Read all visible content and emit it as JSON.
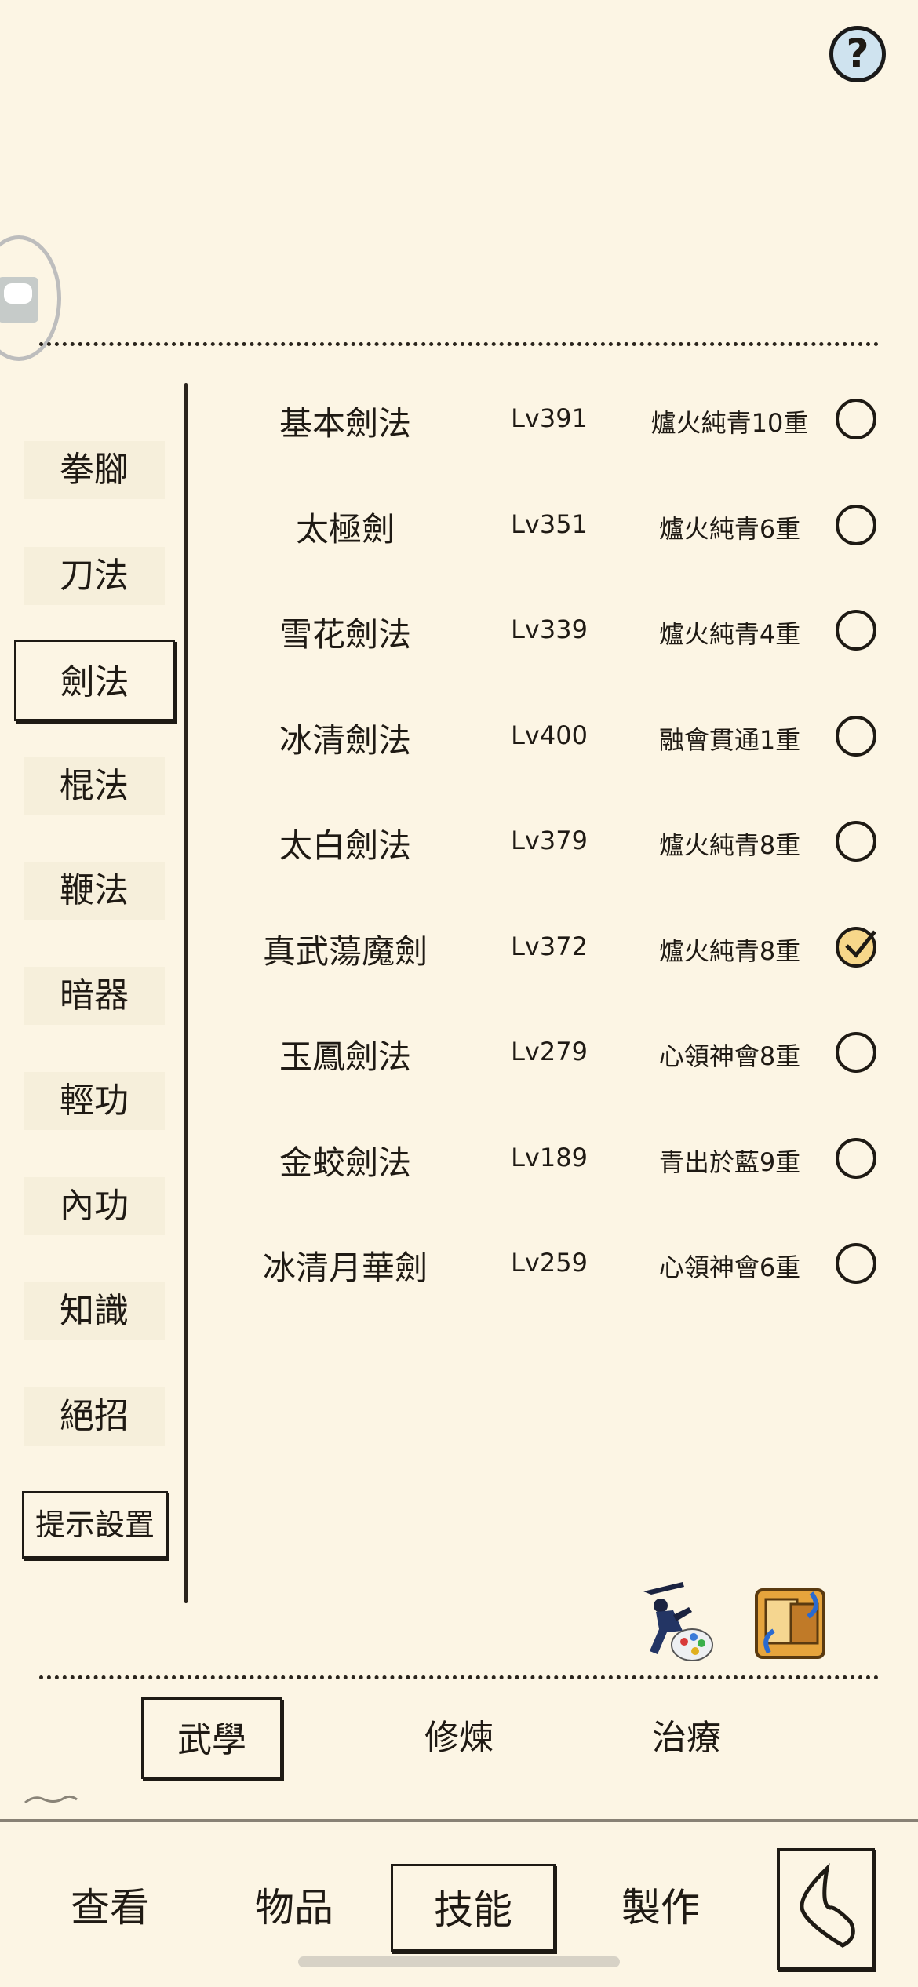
{
  "help": {
    "label": "?"
  },
  "categories": [
    {
      "label": "拳腳"
    },
    {
      "label": "刀法"
    },
    {
      "label": "劍法",
      "selected": true
    },
    {
      "label": "棍法"
    },
    {
      "label": "鞭法"
    },
    {
      "label": "暗器"
    },
    {
      "label": "輕功"
    },
    {
      "label": "內功"
    },
    {
      "label": "知識"
    },
    {
      "label": "絕招"
    }
  ],
  "hint_settings": {
    "label": "提示設置"
  },
  "skills": [
    {
      "name": "基本劍法",
      "level": "Lv391",
      "rank": "爐火純青10重",
      "checked": false
    },
    {
      "name": "太極劍",
      "level": "Lv351",
      "rank": "爐火純青6重",
      "checked": false
    },
    {
      "name": "雪花劍法",
      "level": "Lv339",
      "rank": "爐火純青4重",
      "checked": false
    },
    {
      "name": "冰清劍法",
      "level": "Lv400",
      "rank": "融會貫通1重",
      "checked": false
    },
    {
      "name": "太白劍法",
      "level": "Lv379",
      "rank": "爐火純青8重",
      "checked": false
    },
    {
      "name": "真武蕩魔劍",
      "level": "Lv372",
      "rank": "爐火純青8重",
      "checked": true
    },
    {
      "name": "玉鳳劍法",
      "level": "Lv279",
      "rank": "心領神會8重",
      "checked": false
    },
    {
      "name": "金蛟劍法",
      "level": "Lv189",
      "rank": "青出於藍9重",
      "checked": false
    },
    {
      "name": "冰清月華劍",
      "level": "Lv259",
      "rank": "心領神會6重",
      "checked": false
    }
  ],
  "sub_tabs": [
    {
      "label": "武學",
      "selected": true
    },
    {
      "label": "修煉"
    },
    {
      "label": "治療"
    }
  ],
  "bottom_nav": [
    {
      "label": "查看"
    },
    {
      "label": "物品"
    },
    {
      "label": "技能",
      "selected": true
    },
    {
      "label": "製作"
    }
  ],
  "colors": {
    "background": "#fcf5e4",
    "ink": "#1f1a14",
    "check_fill": "#f7d78a",
    "help_fill": "#cfe3ef"
  }
}
